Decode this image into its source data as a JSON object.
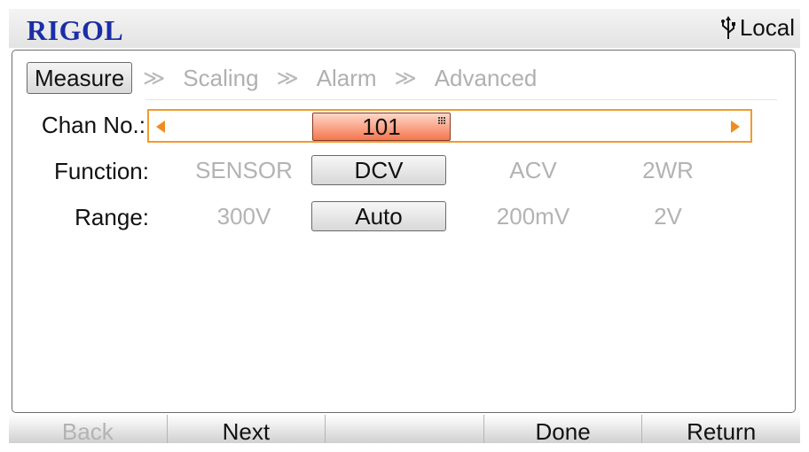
{
  "header": {
    "logo": "RIGOL",
    "status": "Local",
    "status_icon": "usb-icon"
  },
  "tabs": [
    {
      "label": "Measure",
      "active": true
    },
    {
      "label": "Scaling",
      "active": false
    },
    {
      "label": "Alarm",
      "active": false
    },
    {
      "label": "Advanced",
      "active": false
    }
  ],
  "tab_separator": "≫",
  "channel": {
    "label": "Chan No.:",
    "value": "101"
  },
  "function": {
    "label": "Function:",
    "options": [
      "SENSOR",
      "DCV",
      "ACV",
      "2WR"
    ],
    "selected": "DCV"
  },
  "range": {
    "label": "Range:",
    "options": [
      "300V",
      "Auto",
      "200mV",
      "2V"
    ],
    "selected": "Auto"
  },
  "softkeys": [
    {
      "label": "Back",
      "enabled": false
    },
    {
      "label": "Next",
      "enabled": true
    },
    {
      "label": "",
      "enabled": false
    },
    {
      "label": "Done",
      "enabled": true
    },
    {
      "label": "Return",
      "enabled": true
    }
  ],
  "colors": {
    "logo": "#1b2ea6",
    "focus_border": "#f29a2e",
    "value_highlight": "#f4764f"
  }
}
